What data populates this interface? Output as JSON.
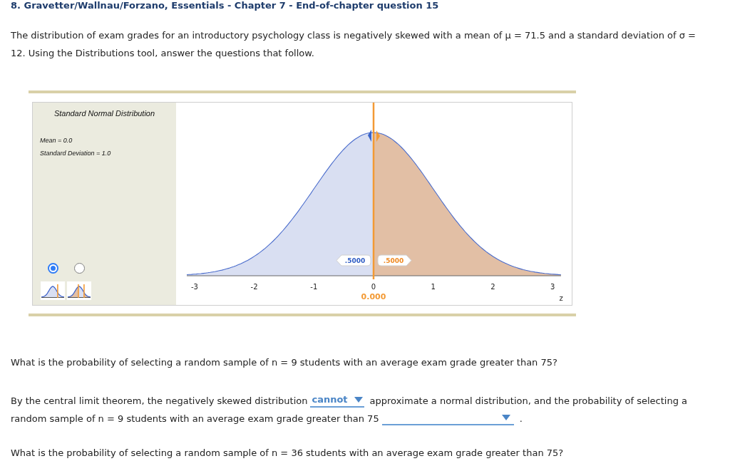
{
  "title": "8. Gravetter/Wallnau/Forzano, Essentials - Chapter 7 - End-of-chapter question 15",
  "intro": "The distribution of exam grades for an introductory psychology class is negatively skewed with a mean of μ = 71.5 and a standard deviation of σ = 12. Using the Distributions tool, answer the questions that follow.",
  "tool": {
    "panel": {
      "title": "Standard Normal Distribution",
      "stats": [
        "Mean = 0.0",
        "Standard Deviation = 1.0"
      ],
      "modes": [
        {
          "kind": "single",
          "selected": true
        },
        {
          "kind": "double",
          "selected": false
        }
      ]
    },
    "plot": {
      "ticks": [
        "-3",
        "-2",
        "-1",
        "0",
        "1",
        "2",
        "3"
      ],
      "axis_label": "z",
      "cut_value": "0.000",
      "regions": [
        {
          "kind": "lower",
          "label": ".5000",
          "color": "#d9dff2"
        },
        {
          "kind": "upper",
          "label": ".5000",
          "color": "#e2bfa5"
        }
      ]
    }
  },
  "questions": [
    {
      "prompt": "What is the probability of selecting a random sample of n = 9 students with an average exam grade greater than 75?",
      "answer_lines": [
        [
          {
            "kind": "text",
            "text": "By the central limit theorem, the negatively skewed distribution"
          },
          {
            "kind": "dropdown",
            "value": "cannot"
          },
          {
            "kind": "text",
            "text": "approximate a normal distribution, and the probability of selecting a"
          }
        ],
        [
          {
            "kind": "text",
            "text": "random sample of n = 9 students with an average exam grade greater than 75"
          },
          {
            "kind": "dropdown"
          },
          {
            "kind": "text",
            "text": "."
          }
        ]
      ]
    },
    {
      "prompt": "What is the probability of selecting a random sample of n = 36 students with an average exam grade greater than 75?"
    }
  ]
}
